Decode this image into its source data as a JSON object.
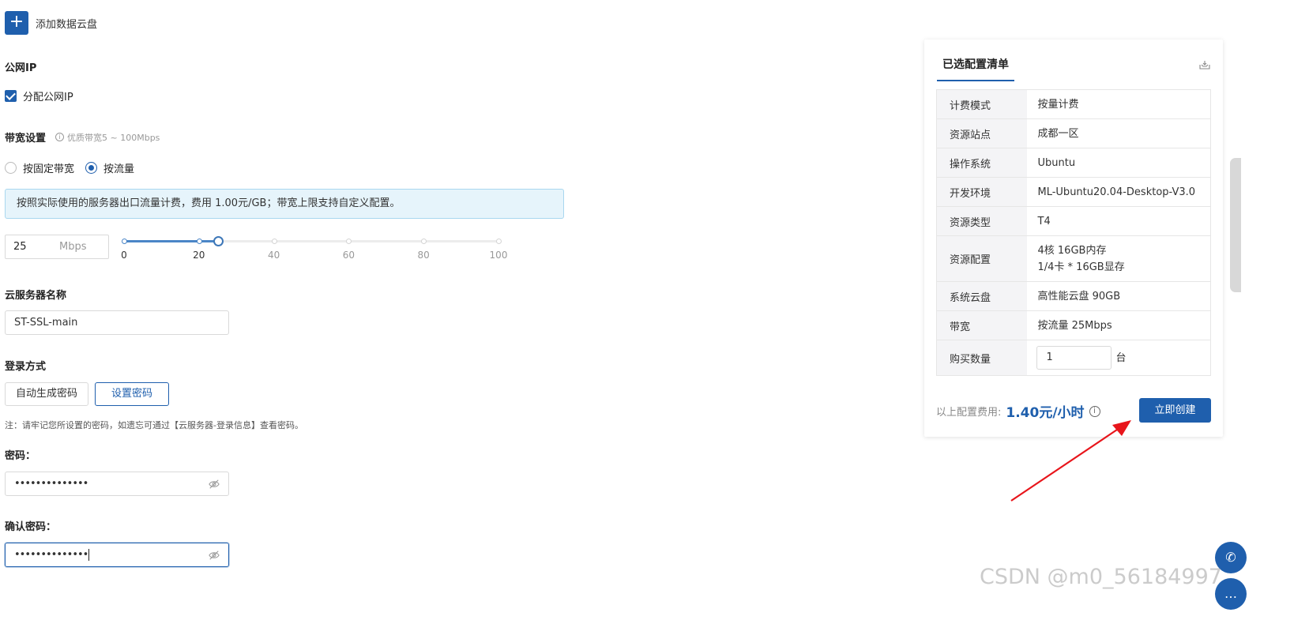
{
  "add_disk": {
    "icon": "plus-icon",
    "label": "添加数据云盘"
  },
  "public_ip": {
    "title": "公网IP",
    "checkbox_label": "分配公网IP",
    "checked": true
  },
  "bandwidth": {
    "title": "带宽设置",
    "hint": "优质带宽5 ~ 100Mbps",
    "options": [
      "按固定带宽",
      "按流量"
    ],
    "selected": "按流量",
    "notice": "按照实际使用的服务器出口流量计费，费用 1.00元/GB；带宽上限支持自定义配置。",
    "value": "25",
    "unit": "Mbps",
    "slider_value": 25,
    "slider_min": 0,
    "slider_max": 100,
    "slider_marks": [
      "0",
      "20",
      "40",
      "60",
      "80",
      "100"
    ]
  },
  "server_name": {
    "title": "云服务器名称",
    "value": "ST-SSL-main"
  },
  "login": {
    "title": "登录方式",
    "options": [
      "自动生成密码",
      "设置密码"
    ],
    "selected": "设置密码",
    "note": "注：请牢记您所设置的密码，如遗忘可通过【云服务器-登录信息】查看密码。"
  },
  "password": {
    "label": "密码：",
    "masked": "••••••••••••••"
  },
  "confirm_password": {
    "label": "确认密码：",
    "masked": "••••••••••••••"
  },
  "summary": {
    "tab": "已选配置清单",
    "rows": [
      {
        "key": "计费模式",
        "value": "按量计费"
      },
      {
        "key": "资源站点",
        "value": "成都一区"
      },
      {
        "key": "操作系统",
        "value": "Ubuntu"
      },
      {
        "key": "开发环境",
        "value": "ML-Ubuntu20.04-Desktop-V3.0"
      },
      {
        "key": "资源类型",
        "value": "T4"
      },
      {
        "key": "资源配置",
        "value": "4核 16GB内存",
        "value2": "1/4卡 * 16GB显存"
      },
      {
        "key": "系统云盘",
        "value": "高性能云盘 90GB"
      },
      {
        "key": "带宽",
        "value": "按流量 25Mbps"
      }
    ],
    "quantity_key": "购买数量",
    "quantity_value": "1",
    "quantity_unit": "台",
    "price_label": "以上配置费用:",
    "price_value": "1.40元/小时",
    "create_label": "立即创建"
  },
  "colors": {
    "primary": "#1f5fad",
    "notice_bg": "#e6f4fb",
    "arrow": "#e8151b"
  },
  "watermark": "CSDN @m0_56184997"
}
